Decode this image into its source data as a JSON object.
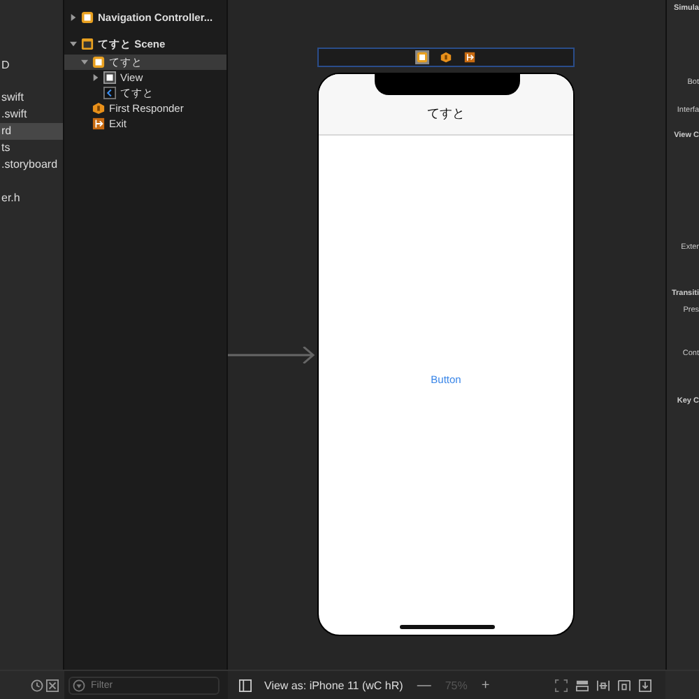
{
  "navigator": {
    "items": [
      {
        "label": "D",
        "selected": false
      },
      {
        "label": "swift",
        "selected": false
      },
      {
        "label": ".swift",
        "selected": false
      },
      {
        "label": "rd",
        "selected": true
      },
      {
        "label": "ts",
        "selected": false
      },
      {
        "label": ".storyboard",
        "selected": false
      },
      {
        "label": "er.h",
        "selected": false
      }
    ]
  },
  "outline": {
    "items": [
      {
        "label": "Navigation Controller...",
        "kind": "controller",
        "expanded": false,
        "selected": false
      },
      {
        "label": "てすと Scene",
        "kind": "scene",
        "expanded": true,
        "selected": false,
        "children": [
          {
            "label": "てすと",
            "kind": "controller",
            "expanded": true,
            "selected": true,
            "children": [
              {
                "label": "View",
                "kind": "view",
                "expanded": false,
                "selected": false
              },
              {
                "label": "てすと",
                "kind": "navitem",
                "selected": false
              }
            ]
          },
          {
            "label": "First Responder",
            "kind": "responder",
            "selected": false
          },
          {
            "label": "Exit",
            "kind": "exit",
            "selected": false
          }
        ]
      }
    ],
    "filter": {
      "placeholder": "Filter"
    }
  },
  "canvas": {
    "dock": [
      {
        "kind": "controller",
        "selected": true
      },
      {
        "kind": "responder",
        "selected": false
      },
      {
        "kind": "exit",
        "selected": false
      }
    ],
    "nav_title": "てすと",
    "button": "Button"
  },
  "bottom_bar": {
    "view_as": "View as: iPhone 11 (wC hR)",
    "zoom_out": "—",
    "zoom": "75%",
    "zoom_in": "+"
  },
  "inspector": {
    "labels": [
      "Simula",
      "Bot",
      "Interfa",
      "View C",
      "Exter",
      "Transiti",
      "Pres",
      "Cont",
      "Key C"
    ]
  }
}
